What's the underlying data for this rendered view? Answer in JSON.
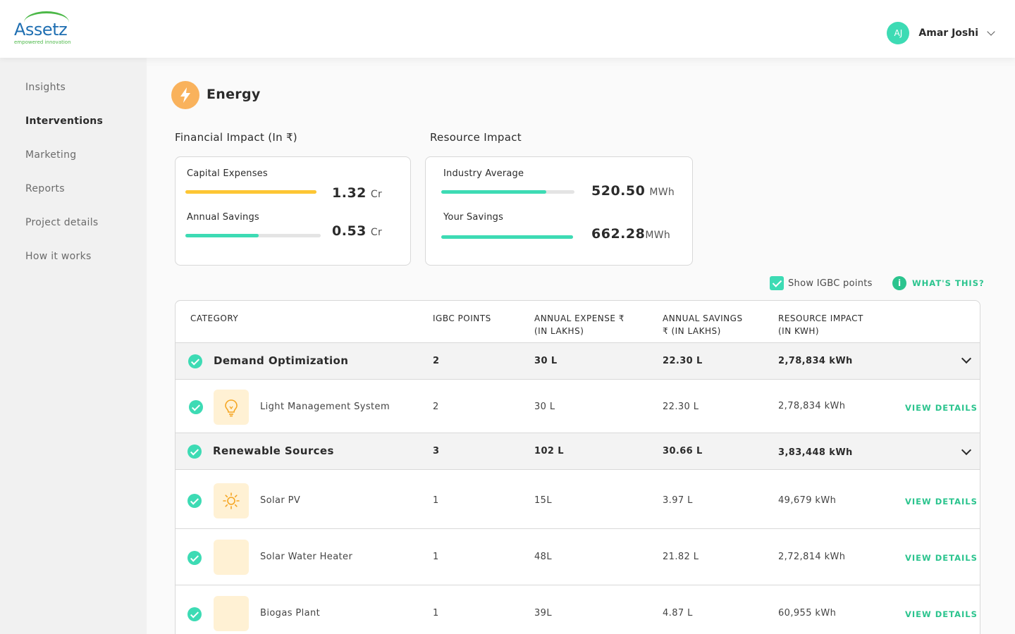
{
  "header": {
    "logo_text": "Assetz",
    "logo_tagline": "empowered innovation",
    "user_initials": "AJ",
    "user_name": "Amar Joshi"
  },
  "sidebar": {
    "items": [
      {
        "label": "Insights"
      },
      {
        "label": "Interventions",
        "active": true
      },
      {
        "label": "Marketing"
      },
      {
        "label": "Reports"
      },
      {
        "label": "Project details"
      },
      {
        "label": "How it works"
      }
    ]
  },
  "page": {
    "title": "Energy",
    "financial_label": "Financial Impact (In ₹)",
    "resource_label": "Resource Impact"
  },
  "financial": {
    "capex_label": "Capital Expenses",
    "capex_value": "1.32",
    "capex_unit": "Cr",
    "capex_fill": 1.0,
    "savings_label": "Annual Savings",
    "savings_value": "0.53",
    "savings_unit": "Cr",
    "savings_fill": 0.54
  },
  "resource": {
    "industry_label": "Industry Average",
    "industry_value": "520.50",
    "industry_unit": "MWh",
    "industry_fill": 0.79,
    "yours_label": "Your Savings",
    "yours_value": "662.28",
    "yours_unit": "MWh",
    "yours_fill": 1.0
  },
  "colors": {
    "accent": "#3ddbb4",
    "link": "#2bc48e",
    "capex_bar": "#fdc634",
    "energy": "#f9b25c"
  },
  "controls": {
    "show_igbc_label": "Show IGBC points",
    "show_igbc_checked": true,
    "whats_this": "WHAT'S THIS?"
  },
  "table": {
    "headers": {
      "category": "CATEGORY",
      "igbc": "IGBC POINTS",
      "expense_1": "ANNUAL EXPENSE ₹",
      "expense_2": "(IN LAKHS)",
      "savings_1": "ANNUAL SAVINGS",
      "savings_2": "₹ (IN LAKHS)",
      "impact_1": "RESOURCE IMPACT",
      "impact_2": "(IN KWH)"
    },
    "view_details": "VIEW DETAILS",
    "rows": [
      {
        "type": "group",
        "name": "Demand Optimization",
        "igbc": "2",
        "expense": "30 L",
        "savings": "22.30 L",
        "impact": "2,78,834 kWh"
      },
      {
        "type": "item",
        "icon": "bulb-icon",
        "name": "Light Management System",
        "igbc": "2",
        "expense": "30 L",
        "savings": "22.30 L",
        "impact": "2,78,834 kWh"
      },
      {
        "type": "group",
        "name": "Renewable Sources",
        "igbc": "3",
        "expense": "102 L",
        "savings": "30.66 L",
        "impact": "3,83,448 kWh"
      },
      {
        "type": "item",
        "icon": "sun-icon",
        "name": "Solar PV",
        "igbc": "1",
        "expense": "15L",
        "savings": "3.97 L",
        "impact": "49,679 kWh"
      },
      {
        "type": "item",
        "icon": "",
        "name": "Solar Water Heater",
        "igbc": "1",
        "expense": "48L",
        "savings": "21.82 L",
        "impact": "2,72,814 kWh"
      },
      {
        "type": "item",
        "icon": "",
        "name": "Biogas Plant",
        "igbc": "1",
        "expense": "39L",
        "savings": "4.87 L",
        "impact": "60,955 kWh"
      }
    ]
  }
}
